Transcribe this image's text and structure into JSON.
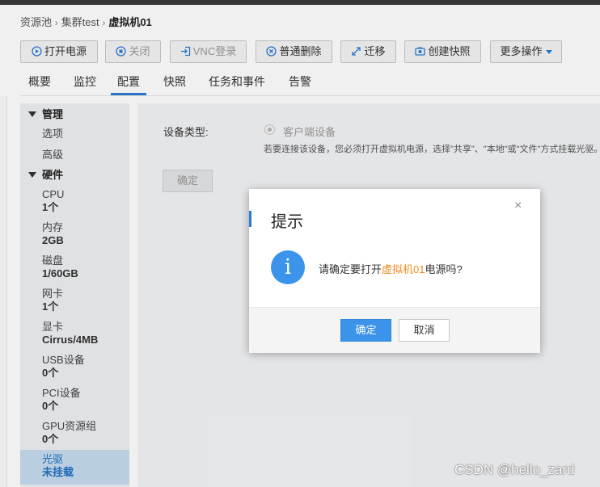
{
  "breadcrumb": {
    "items": [
      "资源池",
      "集群test",
      "虚拟机01"
    ]
  },
  "toolbar": {
    "power_on": "打开电源",
    "power_off": "关闭",
    "vnc": "VNC登录",
    "delete": "普通删除",
    "migrate": "迁移",
    "snapshot": "创建快照",
    "more": "更多操作"
  },
  "tabs": [
    "概要",
    "监控",
    "配置",
    "快照",
    "任务和事件",
    "告警"
  ],
  "active_tab": "配置",
  "sidebar": {
    "section_manage": "管理",
    "manage_items": [
      "选项",
      "高级"
    ],
    "section_hardware": "硬件",
    "hardware_items": [
      {
        "label": "CPU",
        "value": "1个"
      },
      {
        "label": "内存",
        "value": "2GB"
      },
      {
        "label": "磁盘",
        "value": "1/60GB"
      },
      {
        "label": "网卡",
        "value": "1个"
      },
      {
        "label": "显卡",
        "value": "Cirrus/4MB"
      },
      {
        "label": "USB设备",
        "value": "0个"
      },
      {
        "label": "PCI设备",
        "value": "0个"
      },
      {
        "label": "GPU资源组",
        "value": "0个"
      },
      {
        "label": "光驱",
        "value": "未挂载"
      }
    ]
  },
  "content": {
    "device_type_label": "设备类型:",
    "option": "客户端设备",
    "hint": "若要连接该设备，您必须打开虚拟机电源，选择\"共享\"、\"本地\"或\"文件\"方式挂载光驱。",
    "confirm": "确定"
  },
  "dialog": {
    "title": "提示",
    "close": "×",
    "icon": "i",
    "msg_pre": "请确定要打开",
    "msg_vm": "虚拟机01",
    "msg_post": "电源吗?",
    "ok": "确定",
    "cancel": "取消"
  },
  "watermark": "CSDN @hello_zard",
  "colors": {
    "accent": "#2b7cd3",
    "info": "#3b93ea",
    "highlight": "#f08a1c",
    "selected_bg": "#c5dbef"
  }
}
